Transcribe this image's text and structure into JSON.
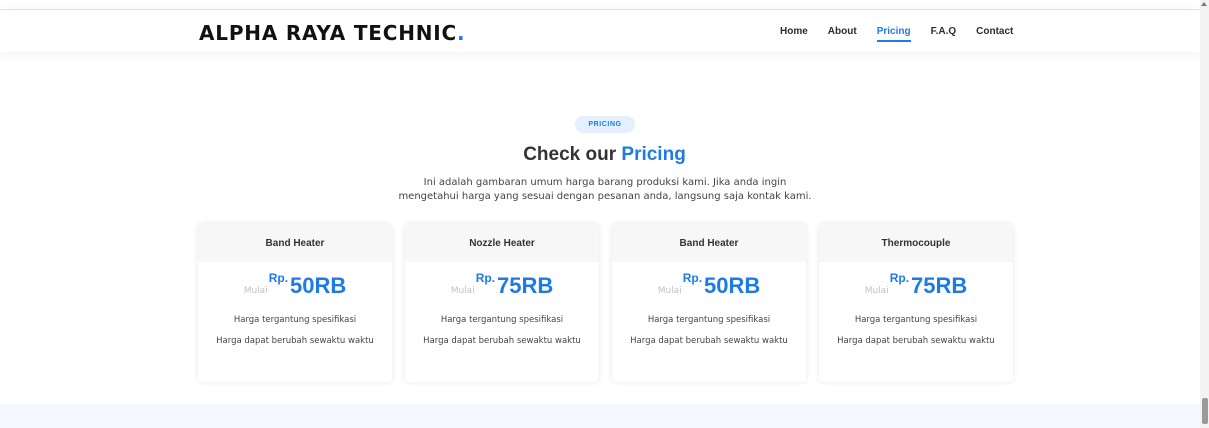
{
  "header": {
    "logo_text": "ALPHA RAYA TECHNIC",
    "logo_dot": ".",
    "nav": [
      {
        "label": "Home"
      },
      {
        "label": "About"
      },
      {
        "label": "Pricing",
        "active": true
      },
      {
        "label": "F.A.Q"
      },
      {
        "label": "Contact"
      }
    ]
  },
  "section": {
    "badge": "PRICING",
    "title_part1": "Check our",
    "title_part2": "Pricing",
    "subtitle": "Ini adalah gambaran umum harga barang produksi kami. Jika anda ingin mengetahui harga yang sesuai dengan pesanan anda, langsung saja kontak kami."
  },
  "cards": [
    {
      "title": "Band Heater",
      "prefix": "Mulai",
      "currency": "Rp.",
      "amount": "50RB",
      "line1": "Harga tergantung spesifikasi",
      "line2": "Harga dapat berubah sewaktu waktu"
    },
    {
      "title": "Nozzle Heater",
      "prefix": "Mulai",
      "currency": "Rp.",
      "amount": "75RB",
      "line1": "Harga tergantung spesifikasi",
      "line2": "Harga dapat berubah sewaktu waktu"
    },
    {
      "title": "Band Heater",
      "prefix": "Mulai",
      "currency": "Rp.",
      "amount": "50RB",
      "line1": "Harga tergantung spesifikasi",
      "line2": "Harga dapat berubah sewaktu waktu"
    },
    {
      "title": "Thermocouple",
      "prefix": "Mulai",
      "currency": "Rp.",
      "amount": "75RB",
      "line1": "Harga tergantung spesifikasi",
      "line2": "Harga dapat berubah sewaktu waktu"
    }
  ],
  "colors": {
    "accent": "#1e7be6",
    "badge_bg": "#e4efff",
    "text": "#444444"
  }
}
